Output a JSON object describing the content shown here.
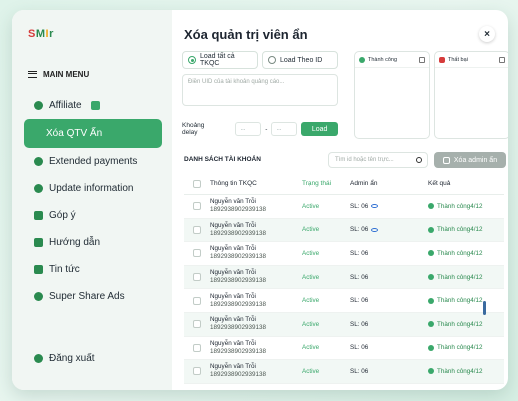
{
  "brand": {
    "s": "S",
    "m": "M",
    "i": "I",
    "r": "r"
  },
  "sidebar": {
    "menu_label": "MAIN MENU",
    "items": [
      {
        "label": "Affiliate",
        "icon": "user-icon"
      },
      {
        "label": "Xóa QTV Ấn",
        "icon": "",
        "active": true
      },
      {
        "label": "Extended payments",
        "icon": "gear-icon"
      },
      {
        "label": "Update information",
        "icon": "info-icon"
      },
      {
        "label": "Góp ý",
        "icon": "thumbs-up-icon"
      },
      {
        "label": "Hướng dẫn",
        "icon": "book-icon"
      },
      {
        "label": "Tin tức",
        "icon": "news-icon"
      },
      {
        "label": "Super Share Ads",
        "icon": "refresh-icon"
      }
    ],
    "logout": "Đăng xuất"
  },
  "main": {
    "title": "Xóa quản trị viên ẩn",
    "close": "×",
    "radio_all": "Load tất cả TKQC",
    "radio_id": "Load Theo ID",
    "textarea_placeholder": "Điền UID của tài khoản quảng cáo...",
    "delay_label": "Khoảng delay",
    "delay_from": "...",
    "delay_sep": "-",
    "delay_to": "...",
    "load_button": "Load",
    "success_label": "Thành công",
    "fail_label": "Thất bại",
    "list_title": "DANH SÁCH TÀI KHOẢN",
    "search_placeholder": "Tìm id hoặc tên trực...",
    "delete_button": "Xóa admin ẩn"
  },
  "table": {
    "headers": {
      "info": "Thông tin TKQC",
      "status": "Trạng thái",
      "admin": "Admin ẩn",
      "result": "Kết quả"
    },
    "rows": [
      {
        "name": "Nguyễn văn Trỗi",
        "phone": "1892938902939138",
        "status": "Active",
        "admin": "SL: 06",
        "result": "Thành công4/12",
        "eye": true
      },
      {
        "name": "Nguyễn văn Trỗi",
        "phone": "1892938902939138",
        "status": "Active",
        "admin": "SL: 06",
        "result": "Thành công4/12",
        "eye": true
      },
      {
        "name": "Nguyễn văn Trỗi",
        "phone": "1892938902939138",
        "status": "Active",
        "admin": "SL: 06",
        "result": "Thành công4/12",
        "eye": false
      },
      {
        "name": "Nguyễn văn Trỗi",
        "phone": "1892938902939138",
        "status": "Active",
        "admin": "SL: 06",
        "result": "Thành công4/12",
        "eye": false
      },
      {
        "name": "Nguyễn văn Trỗi",
        "phone": "1892938902939138",
        "status": "Active",
        "admin": "SL: 06",
        "result": "Thành công4/12",
        "eye": false
      },
      {
        "name": "Nguyễn văn Trỗi",
        "phone": "1892938902939138",
        "status": "Active",
        "admin": "SL: 06",
        "result": "Thành công4/12",
        "eye": false
      },
      {
        "name": "Nguyễn văn Trỗi",
        "phone": "1892938902939138",
        "status": "Active",
        "admin": "SL: 06",
        "result": "Thành công4/12",
        "eye": false
      },
      {
        "name": "Nguyễn văn Trỗi",
        "phone": "1892938902939138",
        "status": "Active",
        "admin": "SL: 06",
        "result": "Thành công4/12",
        "eye": false
      }
    ]
  }
}
